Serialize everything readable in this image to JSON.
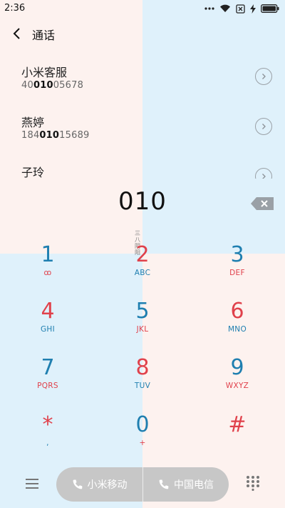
{
  "status_bar": {
    "time": "2:36",
    "icons": [
      "more-dots-icon",
      "wifi-icon",
      "sim-x-icon",
      "charging-bolt-icon",
      "battery-icon"
    ]
  },
  "header": {
    "title": "通话",
    "back_icon": "chevron-left-icon"
  },
  "contacts": [
    {
      "name": "小米客服",
      "number_prefix": "40",
      "number_match": "010",
      "number_suffix": "05678"
    },
    {
      "name": "燕婷",
      "number_prefix": "184",
      "number_match": "010",
      "number_suffix": "15689"
    },
    {
      "name": "子玲",
      "number_prefix": "",
      "number_match": "",
      "number_suffix": ""
    }
  ],
  "dialer": {
    "number": "010"
  },
  "tiny_mark": "三八阴阳",
  "keys": [
    {
      "digit": "1",
      "sub": "ꝏ",
      "digit_color": "#1f7fb0",
      "sub_color": "#e0414b"
    },
    {
      "digit": "2",
      "sub": "ABC",
      "digit_color": "#e0414b",
      "sub_color": "#1f7fb0"
    },
    {
      "digit": "3",
      "sub": "DEF",
      "digit_color": "#1f7fb0",
      "sub_color": "#e0414b"
    },
    {
      "digit": "4",
      "sub": "GHI",
      "digit_color": "#e0414b",
      "sub_color": "#1f7fb0"
    },
    {
      "digit": "5",
      "sub": "JKL",
      "digit_color": "#1f7fb0",
      "sub_color": "#e0414b"
    },
    {
      "digit": "6",
      "sub": "MNO",
      "digit_color": "#e0414b",
      "sub_color": "#1f7fb0"
    },
    {
      "digit": "7",
      "sub": "PQRS",
      "digit_color": "#1f7fb0",
      "sub_color": "#e0414b"
    },
    {
      "digit": "8",
      "sub": "TUV",
      "digit_color": "#e0414b",
      "sub_color": "#1f7fb0"
    },
    {
      "digit": "9",
      "sub": "WXYZ",
      "digit_color": "#1f7fb0",
      "sub_color": "#e0414b"
    },
    {
      "digit": "*",
      "sub": ",",
      "digit_color": "#e0414b",
      "sub_color": "#1f7fb0"
    },
    {
      "digit": "0",
      "sub": "+",
      "digit_color": "#1f7fb0",
      "sub_color": "#e0414b"
    },
    {
      "digit": "#",
      "sub": "",
      "digit_color": "#e0414b",
      "sub_color": "#1f7fb0"
    }
  ],
  "bottom_bar": {
    "sim1_label": "小米移动",
    "sim2_label": "中国电信",
    "menu_icon": "hamburger-menu-icon",
    "dialpad_icon": "dialpad-grid-icon"
  },
  "colors": {
    "accent_red": "#e0414b",
    "accent_blue": "#1f7fb0",
    "pink_bg": "#fdf2ef",
    "blue_bg": "#dff1fb",
    "call_pill": "#c7c7c7"
  }
}
